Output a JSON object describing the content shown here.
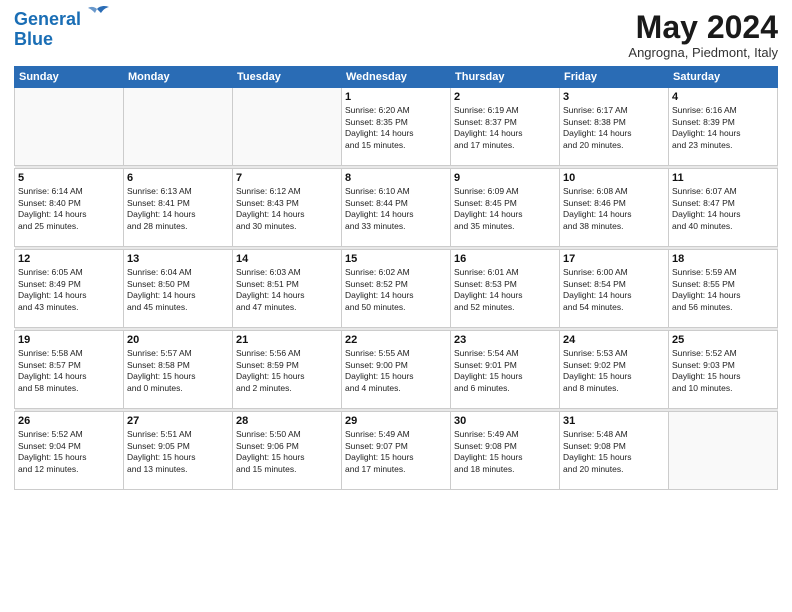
{
  "logo": {
    "line1": "General",
    "line2": "Blue"
  },
  "title": "May 2024",
  "subtitle": "Angrogna, Piedmont, Italy",
  "weekdays": [
    "Sunday",
    "Monday",
    "Tuesday",
    "Wednesday",
    "Thursday",
    "Friday",
    "Saturday"
  ],
  "weeks": [
    [
      {
        "day": "",
        "info": ""
      },
      {
        "day": "",
        "info": ""
      },
      {
        "day": "",
        "info": ""
      },
      {
        "day": "1",
        "info": "Sunrise: 6:20 AM\nSunset: 8:35 PM\nDaylight: 14 hours\nand 15 minutes."
      },
      {
        "day": "2",
        "info": "Sunrise: 6:19 AM\nSunset: 8:37 PM\nDaylight: 14 hours\nand 17 minutes."
      },
      {
        "day": "3",
        "info": "Sunrise: 6:17 AM\nSunset: 8:38 PM\nDaylight: 14 hours\nand 20 minutes."
      },
      {
        "day": "4",
        "info": "Sunrise: 6:16 AM\nSunset: 8:39 PM\nDaylight: 14 hours\nand 23 minutes."
      }
    ],
    [
      {
        "day": "5",
        "info": "Sunrise: 6:14 AM\nSunset: 8:40 PM\nDaylight: 14 hours\nand 25 minutes."
      },
      {
        "day": "6",
        "info": "Sunrise: 6:13 AM\nSunset: 8:41 PM\nDaylight: 14 hours\nand 28 minutes."
      },
      {
        "day": "7",
        "info": "Sunrise: 6:12 AM\nSunset: 8:43 PM\nDaylight: 14 hours\nand 30 minutes."
      },
      {
        "day": "8",
        "info": "Sunrise: 6:10 AM\nSunset: 8:44 PM\nDaylight: 14 hours\nand 33 minutes."
      },
      {
        "day": "9",
        "info": "Sunrise: 6:09 AM\nSunset: 8:45 PM\nDaylight: 14 hours\nand 35 minutes."
      },
      {
        "day": "10",
        "info": "Sunrise: 6:08 AM\nSunset: 8:46 PM\nDaylight: 14 hours\nand 38 minutes."
      },
      {
        "day": "11",
        "info": "Sunrise: 6:07 AM\nSunset: 8:47 PM\nDaylight: 14 hours\nand 40 minutes."
      }
    ],
    [
      {
        "day": "12",
        "info": "Sunrise: 6:05 AM\nSunset: 8:49 PM\nDaylight: 14 hours\nand 43 minutes."
      },
      {
        "day": "13",
        "info": "Sunrise: 6:04 AM\nSunset: 8:50 PM\nDaylight: 14 hours\nand 45 minutes."
      },
      {
        "day": "14",
        "info": "Sunrise: 6:03 AM\nSunset: 8:51 PM\nDaylight: 14 hours\nand 47 minutes."
      },
      {
        "day": "15",
        "info": "Sunrise: 6:02 AM\nSunset: 8:52 PM\nDaylight: 14 hours\nand 50 minutes."
      },
      {
        "day": "16",
        "info": "Sunrise: 6:01 AM\nSunset: 8:53 PM\nDaylight: 14 hours\nand 52 minutes."
      },
      {
        "day": "17",
        "info": "Sunrise: 6:00 AM\nSunset: 8:54 PM\nDaylight: 14 hours\nand 54 minutes."
      },
      {
        "day": "18",
        "info": "Sunrise: 5:59 AM\nSunset: 8:55 PM\nDaylight: 14 hours\nand 56 minutes."
      }
    ],
    [
      {
        "day": "19",
        "info": "Sunrise: 5:58 AM\nSunset: 8:57 PM\nDaylight: 14 hours\nand 58 minutes."
      },
      {
        "day": "20",
        "info": "Sunrise: 5:57 AM\nSunset: 8:58 PM\nDaylight: 15 hours\nand 0 minutes."
      },
      {
        "day": "21",
        "info": "Sunrise: 5:56 AM\nSunset: 8:59 PM\nDaylight: 15 hours\nand 2 minutes."
      },
      {
        "day": "22",
        "info": "Sunrise: 5:55 AM\nSunset: 9:00 PM\nDaylight: 15 hours\nand 4 minutes."
      },
      {
        "day": "23",
        "info": "Sunrise: 5:54 AM\nSunset: 9:01 PM\nDaylight: 15 hours\nand 6 minutes."
      },
      {
        "day": "24",
        "info": "Sunrise: 5:53 AM\nSunset: 9:02 PM\nDaylight: 15 hours\nand 8 minutes."
      },
      {
        "day": "25",
        "info": "Sunrise: 5:52 AM\nSunset: 9:03 PM\nDaylight: 15 hours\nand 10 minutes."
      }
    ],
    [
      {
        "day": "26",
        "info": "Sunrise: 5:52 AM\nSunset: 9:04 PM\nDaylight: 15 hours\nand 12 minutes."
      },
      {
        "day": "27",
        "info": "Sunrise: 5:51 AM\nSunset: 9:05 PM\nDaylight: 15 hours\nand 13 minutes."
      },
      {
        "day": "28",
        "info": "Sunrise: 5:50 AM\nSunset: 9:06 PM\nDaylight: 15 hours\nand 15 minutes."
      },
      {
        "day": "29",
        "info": "Sunrise: 5:49 AM\nSunset: 9:07 PM\nDaylight: 15 hours\nand 17 minutes."
      },
      {
        "day": "30",
        "info": "Sunrise: 5:49 AM\nSunset: 9:08 PM\nDaylight: 15 hours\nand 18 minutes."
      },
      {
        "day": "31",
        "info": "Sunrise: 5:48 AM\nSunset: 9:08 PM\nDaylight: 15 hours\nand 20 minutes."
      },
      {
        "day": "",
        "info": ""
      }
    ]
  ]
}
